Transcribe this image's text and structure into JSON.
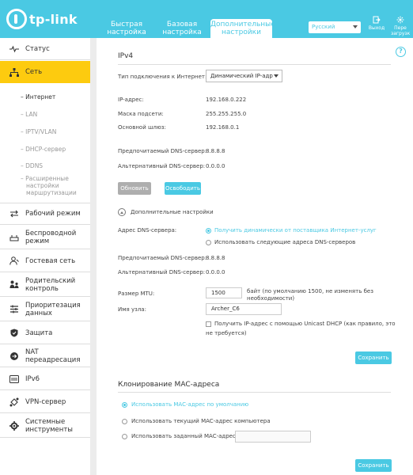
{
  "header": {
    "logo": "tp-link",
    "tabs": [
      {
        "label1": "Быстрая",
        "label2": "настройка"
      },
      {
        "label1": "Базовая",
        "label2": "настройка"
      },
      {
        "label1": "Дополнительные",
        "label2": "настройки"
      }
    ],
    "language": "Русский",
    "logout_label": "Выход",
    "reboot_label1": "Пере",
    "reboot_label2": "загрузк"
  },
  "sidebar": {
    "items": [
      {
        "label": "Статус",
        "icon": "pulse-icon"
      },
      {
        "label": "Сеть",
        "icon": "network-icon"
      },
      {
        "label": "Рабочий режим",
        "icon": "mode-icon"
      },
      {
        "label1": "Беспроводной",
        "label2": "режим",
        "icon": "wifi-icon"
      },
      {
        "label": "Гостевая сеть",
        "icon": "guest-icon"
      },
      {
        "label1": "Родительский",
        "label2": "контроль",
        "icon": "parental-icon"
      },
      {
        "label1": "Приоритезация",
        "label2": "данных",
        "icon": "priority-icon"
      },
      {
        "label": "Защита",
        "icon": "shield-icon"
      },
      {
        "label": "NAT переадресация",
        "icon": "nat-icon"
      },
      {
        "label": "IPv6",
        "icon": "ipv6-icon"
      },
      {
        "label": "VPN-сервер",
        "icon": "vpn-icon"
      },
      {
        "label1": "Системные",
        "label2": "инструменты",
        "icon": "gear-icon"
      }
    ],
    "subitems": {
      "internet": "Интернет",
      "lan": "LAN",
      "iptv": "IPTV/VLAN",
      "dhcp": "DHCP-сервер",
      "ddns": "DDNS",
      "routing1": "Расширенные",
      "routing2": "настройки",
      "routing3": "маршрутизации"
    }
  },
  "ipv4": {
    "title": "IPv4",
    "conn_type_label": "Тип подключения к Интернет:",
    "conn_type_value": "Динамический IP-адр",
    "ip_label": "IP-адрес:",
    "ip_value": "192.168.0.222",
    "mask_label": "Маска подсети:",
    "mask_value": "255.255.255.0",
    "gw_label": "Основной шлюз:",
    "gw_value": "192.168.0.1",
    "dns1_label": "Предпочитаемый DNS-сервер:",
    "dns1_value": "8.8.8.8",
    "dns2_label": "Альтернативный DNS-сервер:",
    "dns2_value": "0.0.0.0",
    "renew_btn": "Обновить",
    "release_btn": "Освободить"
  },
  "advanced": {
    "toggle_label": "Дополнительные настройки",
    "dns_addr_label": "Адрес DNS-сервера:",
    "dns_opt1": "Получить динамически от поставщика Интернет-услуг",
    "dns_opt2": "Использовать следующие адреса DNS-серверов",
    "pref_dns_label": "Предпочитаемый DNS-сервер:",
    "pref_dns_value": "8.8.8.8",
    "alt_dns_label": "Альтернативный DNS-сервер:",
    "alt_dns_value": "0.0.0.0",
    "mtu_label": "Размер MTU:",
    "mtu_value": "1500",
    "mtu_hint1": "байт (по умолчанию 1500, не изменять без",
    "mtu_hint2": "необходимости)",
    "host_label": "Имя узла:",
    "host_value": "Archer_C6",
    "unicast1": "Получить IP-адрес с помощью Unicast DHCP (как правило, это",
    "unicast2": "не требуется)",
    "save_btn": "Сохранить"
  },
  "mac": {
    "title": "Клонирование MAC-адреса",
    "opt1": "Использовать MAC-адрес по умолчанию",
    "opt2": "Использовать текущий MAC-адрес компьютера",
    "opt3": "Использовать заданный MAC-адрес",
    "save_btn": "Сохранить"
  },
  "colors": {
    "accent": "#4ac9e3",
    "active_nav": "#fdcb0f"
  }
}
